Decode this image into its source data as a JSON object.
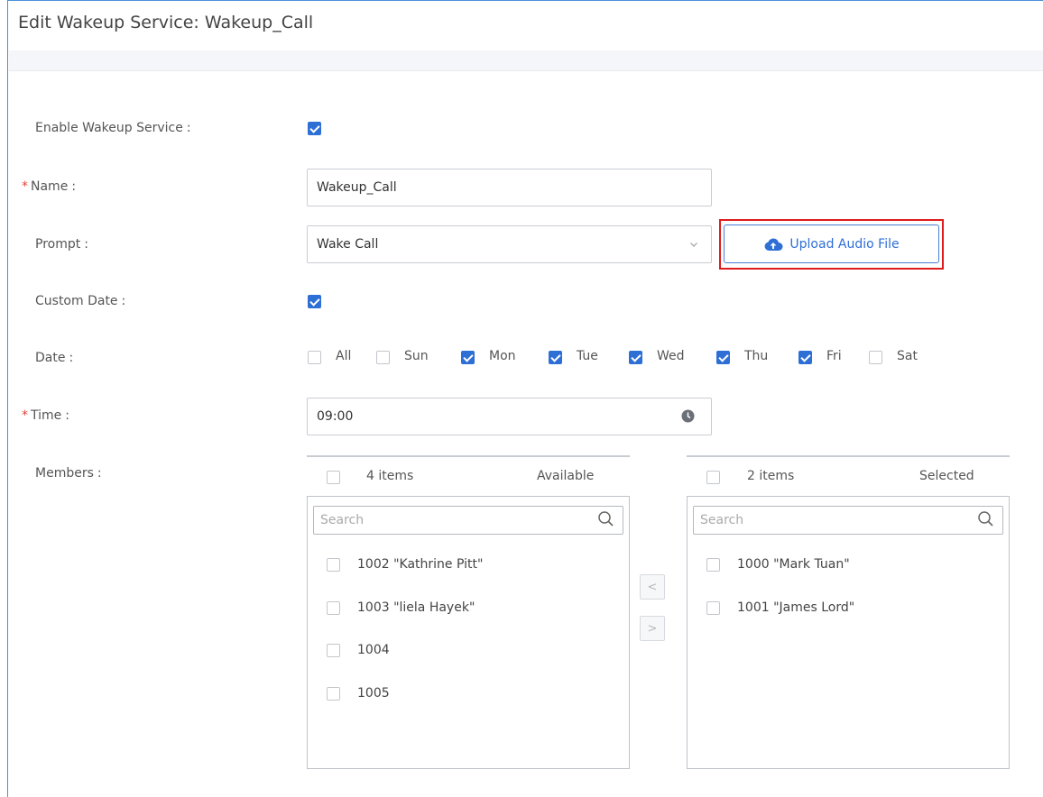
{
  "title": "Edit Wakeup Service: Wakeup_Call",
  "form": {
    "enable_label": "Enable Wakeup Service",
    "enable_checked": true,
    "name_label": "Name",
    "name_value": "Wakeup_Call",
    "prompt_label": "Prompt",
    "prompt_value": "Wake Call",
    "upload_label": "Upload Audio File",
    "custom_date_label": "Custom Date",
    "custom_date_checked": true,
    "date_label": "Date",
    "days": [
      {
        "label": "All",
        "checked": false
      },
      {
        "label": "Sun",
        "checked": false
      },
      {
        "label": "Mon",
        "checked": true
      },
      {
        "label": "Tue",
        "checked": true
      },
      {
        "label": "Wed",
        "checked": true
      },
      {
        "label": "Thu",
        "checked": true
      },
      {
        "label": "Fri",
        "checked": true
      },
      {
        "label": "Sat",
        "checked": false
      }
    ],
    "time_label": "Time",
    "time_value": "09:00",
    "members_label": "Members",
    "colon": ":",
    "required_mark": "*"
  },
  "transfer": {
    "available": {
      "count": "4 items",
      "title": "Available",
      "search_placeholder": "Search",
      "items": [
        "1002 \"Kathrine Pitt\"",
        "1003 \"liela Hayek\"",
        "1004",
        "1005"
      ]
    },
    "selected": {
      "count": "2 items",
      "title": "Selected",
      "search_placeholder": "Search",
      "items": [
        "1000 \"Mark Tuan\"",
        "1001 \"James Lord\""
      ]
    },
    "move_left": "<",
    "move_right": ">"
  },
  "colors": {
    "accent": "#2e6fd6",
    "highlight": "#e01b1b",
    "required": "#e0413b"
  }
}
